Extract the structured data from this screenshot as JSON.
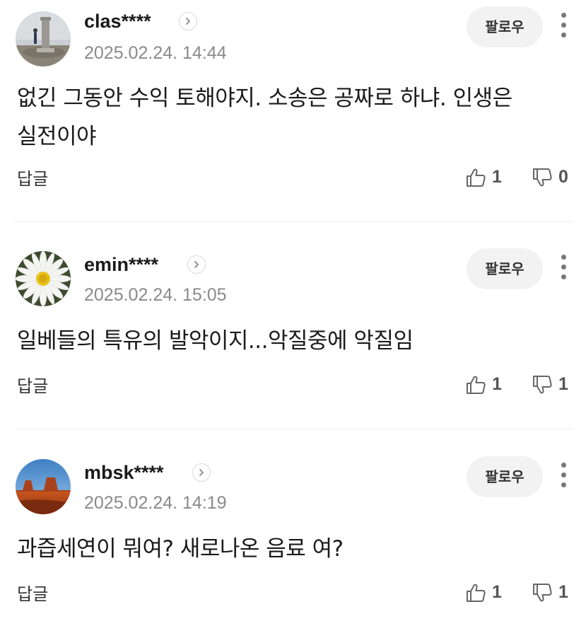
{
  "follow_label": "팔로우",
  "reply_label": "답글",
  "comments": [
    {
      "username": "clas****",
      "timestamp": "2025.02.24. 14:44",
      "text": "없긴 그동안 수익 토해야지. 소송은 공짜로 하냐. 인생은 실전이야",
      "likes": "1",
      "dislikes": "0",
      "avatar": "monument-landscape-photo"
    },
    {
      "username": "emin****",
      "timestamp": "2025.02.24. 15:05",
      "text": "일베들의 특유의 발악이지...악질중에 악질임",
      "likes": "1",
      "dislikes": "1",
      "avatar": "daisy-flower-photo"
    },
    {
      "username": "mbsk****",
      "timestamp": "2025.02.24. 14:19",
      "text": "과즙세연이 뭐여? 새로나온 음료 여?",
      "likes": "1",
      "dislikes": "1",
      "avatar": "desert-mesa-photo"
    }
  ],
  "colors": {
    "background": "#ffffff",
    "text": "#1a1a1a",
    "meta": "#8a8a8a",
    "follow_bg": "#f2f2f2",
    "divider": "#ececec",
    "icon": "#555555"
  }
}
